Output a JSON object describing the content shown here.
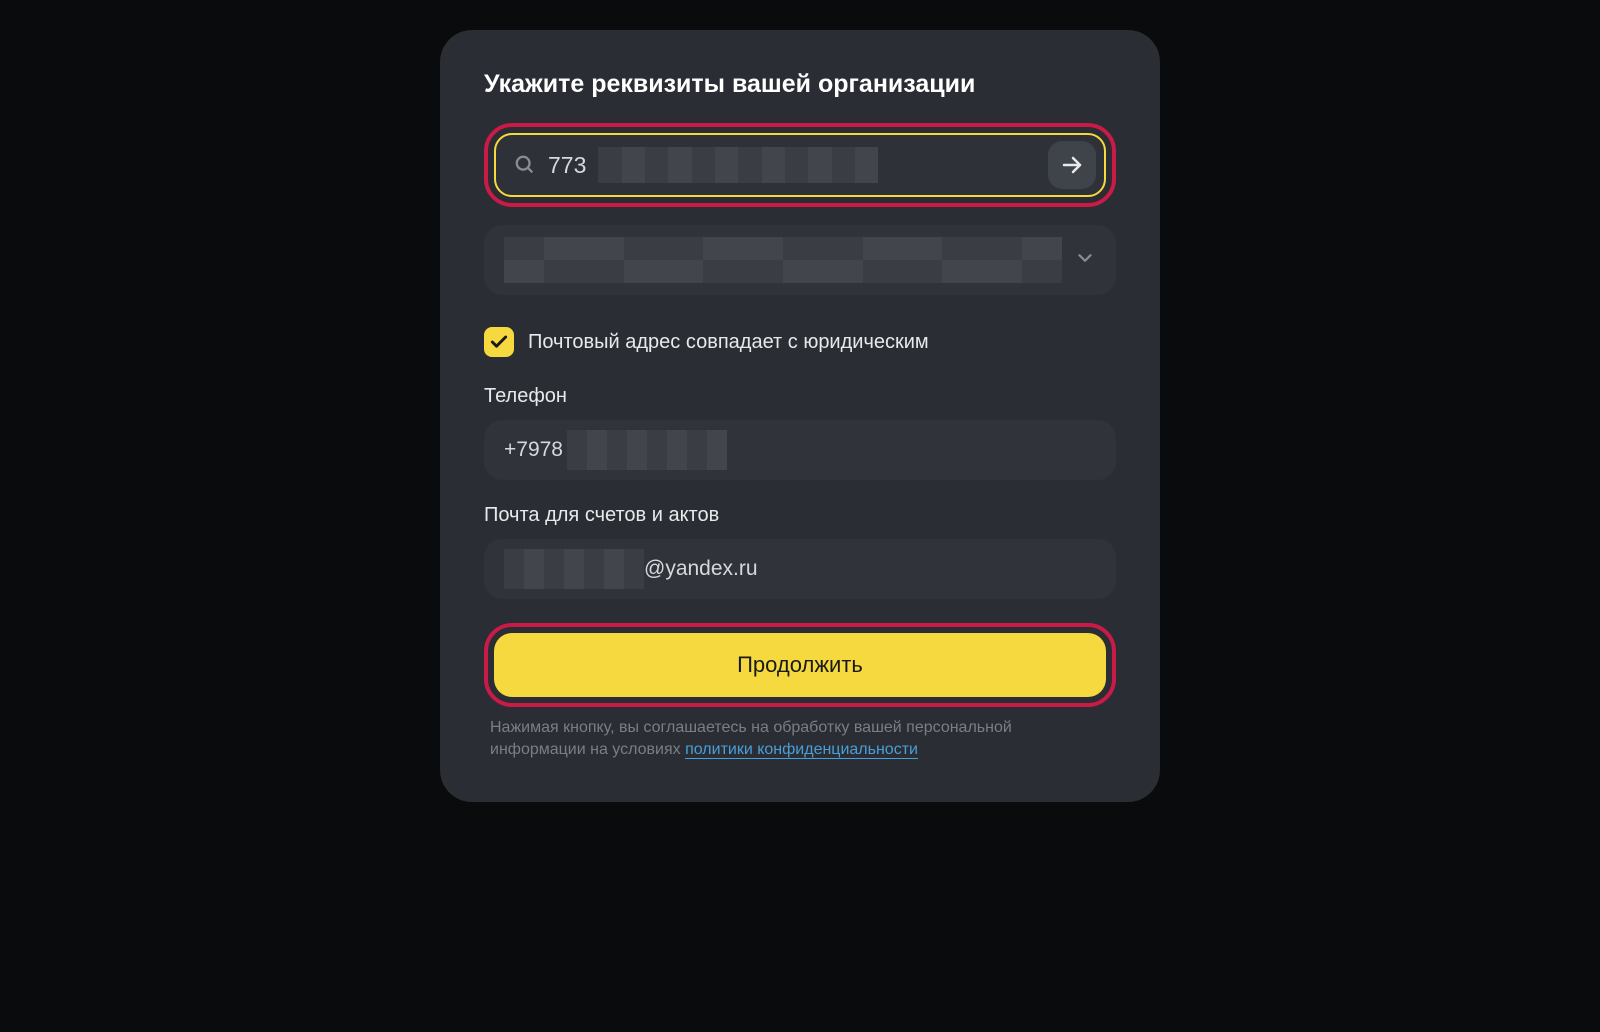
{
  "form": {
    "title": "Укажите реквизиты вашей организации",
    "search": {
      "visible_value": "773"
    },
    "checkbox": {
      "label": "Почтовый адрес совпадает с юридическим",
      "checked": true
    },
    "phone": {
      "label": "Телефон",
      "visible_value": "+7978"
    },
    "email": {
      "label": "Почта для счетов и актов",
      "visible_suffix": "@yandex.ru"
    },
    "continue_label": "Продолжить",
    "disclaimer": {
      "text_before": "Нажимая кнопку, вы соглашаетесь на обработку вашей персональной информации на условиях ",
      "link_text": "политики конфиденциальности"
    }
  },
  "colors": {
    "accent": "#f5d93f",
    "highlight_border": "#c91a48",
    "link": "#4a9fd8"
  }
}
